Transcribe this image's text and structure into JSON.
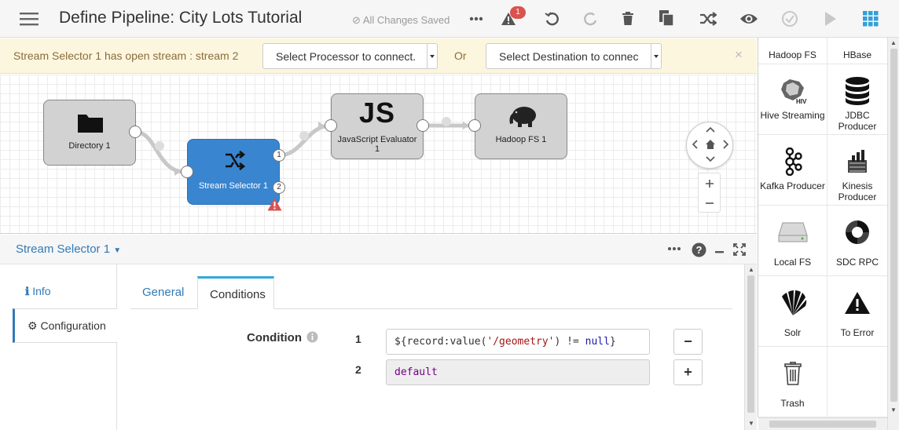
{
  "header": {
    "title": "Define Pipeline:  City Lots Tutorial",
    "save_status": "All Changes Saved",
    "issues_count": "1"
  },
  "warning": {
    "message": "Stream Selector 1 has open stream : stream 2",
    "processor_select": "Select Processor to connect.",
    "or": "Or",
    "destination_select": "Select Destination to connec",
    "close": "×"
  },
  "canvas": {
    "stages": [
      {
        "label": "Directory 1"
      },
      {
        "label": "Stream Selector 1",
        "ports": [
          "1",
          "2"
        ]
      },
      {
        "label": "JavaScript Evaluator 1",
        "icon_text": "JS"
      },
      {
        "label": "Hadoop FS 1"
      }
    ]
  },
  "panel": {
    "title": "Stream Selector 1",
    "left_tabs": [
      "Info",
      "Configuration"
    ],
    "tabs": [
      "General",
      "Conditions"
    ],
    "condition_label": "Condition",
    "conditions": [
      {
        "num": "1",
        "expr": "${record:value('/geometry') != null}"
      },
      {
        "num": "2",
        "expr": "default"
      }
    ],
    "remove": "−",
    "add": "+"
  },
  "library": {
    "items": [
      {
        "name": "Hadoop FS",
        "icon": "hadoop-icon"
      },
      {
        "name": "HBase",
        "icon": "hbase-icon"
      },
      {
        "name": "Hive Streaming",
        "icon": "hive-icon"
      },
      {
        "name": "JDBC Producer",
        "icon": "database-icon"
      },
      {
        "name": "Kafka Producer",
        "icon": "kafka-icon"
      },
      {
        "name": "Kinesis Producer",
        "icon": "kinesis-icon"
      },
      {
        "name": "Local FS",
        "icon": "hard-drive-icon"
      },
      {
        "name": "SDC RPC",
        "icon": "sdc-rpc-icon"
      },
      {
        "name": "Solr",
        "icon": "solr-icon"
      },
      {
        "name": "To Error",
        "icon": "warning-icon"
      },
      {
        "name": "Trash",
        "icon": "trash-icon"
      }
    ]
  },
  "colors": {
    "accent": "#337ab7",
    "selected_stage": "#3a85cf",
    "warning_bg": "#fcf6df",
    "error": "#d9534f"
  }
}
